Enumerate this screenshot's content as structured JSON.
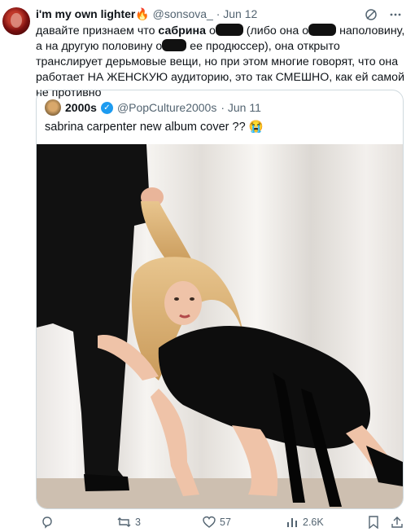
{
  "post": {
    "display_name": "i'm my own lighter",
    "handle": "@sonsova_",
    "date": "· Jun 12",
    "text_parts": [
      "давайте признаем что ",
      "сабрина",
      " о",
      " (либо она о",
      " наполовину, а на другую половину о",
      " ее продюссер), она открыто транслирует дерьмовые вещи, но при этом многие говорят, что она работает НА ЖЕНСКУЮ аудиторию, это так СМЕШНО, как ей самой не противно"
    ]
  },
  "quote": {
    "display_name": "2000s",
    "handle": "@PopCulture2000s",
    "date": "· Jun 11",
    "text": "sabrina carpenter new album cover ?? 😭"
  },
  "actions": {
    "replies": "",
    "reposts": "3",
    "likes": "57",
    "views": "2.6K"
  },
  "icons": [
    "grok-icon",
    "more-icon",
    "reply-icon",
    "repost-icon",
    "like-icon",
    "views-icon",
    "bookmark-icon",
    "share-icon"
  ],
  "colors": {
    "link_blue": "#1d9bf0",
    "muted": "#536471",
    "border": "#cfd9de"
  }
}
